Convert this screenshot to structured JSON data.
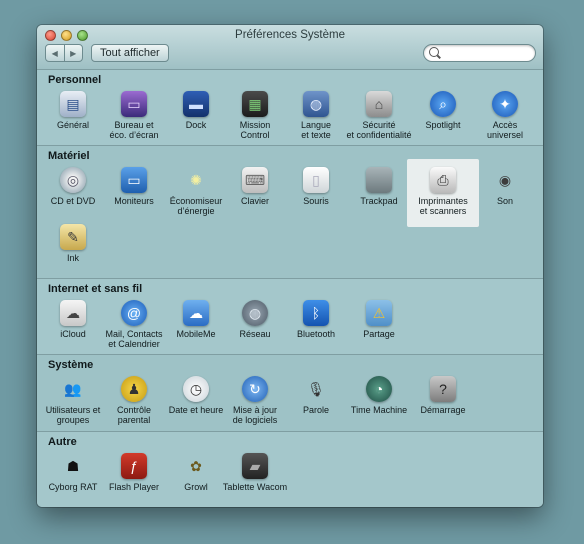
{
  "window": {
    "title": "Préférences Système"
  },
  "toolbar": {
    "back_glyph": "◀",
    "forward_glyph": "▶",
    "show_all_label": "Tout afficher",
    "search_placeholder": ""
  },
  "sections": {
    "personnel": {
      "title": "Personnel",
      "items": [
        "Général",
        "Bureau et\néco. d’écran",
        "Dock",
        "Mission\nControl",
        "Langue\net texte",
        "Sécurité\net confidentialité",
        "Spotlight",
        "Accès\nuniversel"
      ]
    },
    "materiel": {
      "title": "Matériel",
      "items": [
        "CD et DVD",
        "Moniteurs",
        "Économiseur\nd’énergie",
        "Clavier",
        "Souris",
        "Trackpad",
        "Imprimantes\net scanners",
        "Son",
        "Ink"
      ]
    },
    "internet": {
      "title": "Internet et sans fil",
      "items": [
        "iCloud",
        "Mail, Contacts\net Calendrier",
        "MobileMe",
        "Réseau",
        "Bluetooth",
        "Partage"
      ]
    },
    "systeme": {
      "title": "Système",
      "items": [
        "Utilisateurs et\ngroupes",
        "Contrôle\nparental",
        "Date et heure",
        "Mise à jour\nde logiciels",
        "Parole",
        "Time Machine",
        "Démarrage"
      ]
    },
    "autre": {
      "title": "Autre",
      "items": [
        "Cyborg RAT",
        "Flash Player",
        "Growl",
        "Tablette Wacom"
      ]
    }
  },
  "icons": {
    "general": "general-file-icon",
    "desktop": "desktop-screensaver-icon",
    "dock": "dock-icon",
    "mission": "mission-control-icon",
    "language": "language-flag-icon",
    "security": "security-house-icon",
    "spotlight": "spotlight-magnifier-icon",
    "access": "accessibility-person-icon"
  },
  "colors": {
    "window_bg": "#a4c7cb",
    "selected_bg": "#e9eeee",
    "desktop_bg": "#6f9aa3"
  }
}
